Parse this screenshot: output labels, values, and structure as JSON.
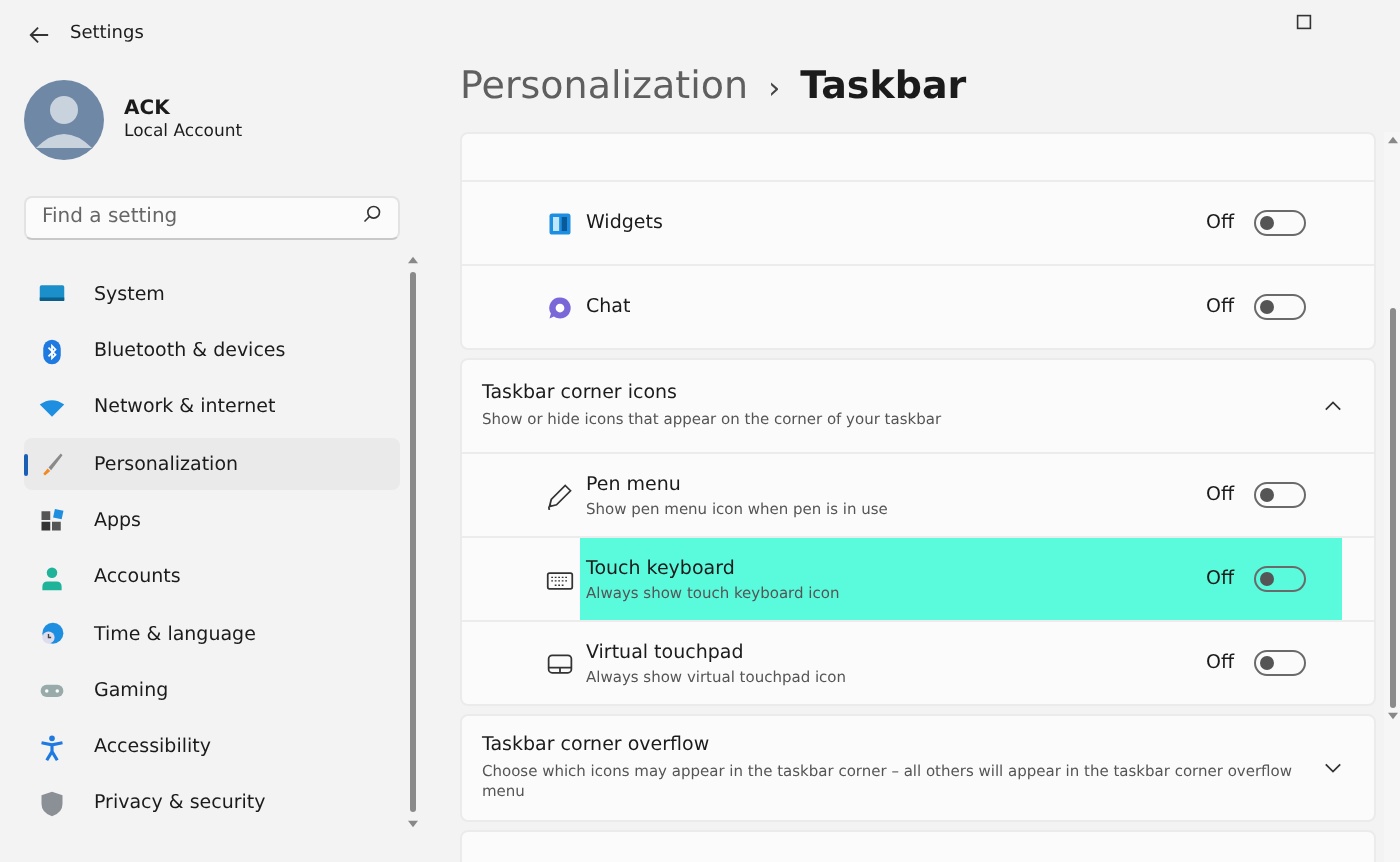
{
  "window": {
    "title": "Settings"
  },
  "account": {
    "name": "ACK",
    "type": "Local Account"
  },
  "search": {
    "placeholder": "Find a setting"
  },
  "sidebar": {
    "items": [
      {
        "label": "System",
        "kind": "system",
        "selected": false
      },
      {
        "label": "Bluetooth & devices",
        "kind": "bluetooth",
        "selected": false
      },
      {
        "label": "Network & internet",
        "kind": "network",
        "selected": false
      },
      {
        "label": "Personalization",
        "kind": "brush",
        "selected": true
      },
      {
        "label": "Apps",
        "kind": "apps",
        "selected": false
      },
      {
        "label": "Accounts",
        "kind": "person",
        "selected": false
      },
      {
        "label": "Time & language",
        "kind": "globe",
        "selected": false
      },
      {
        "label": "Gaming",
        "kind": "gamepad",
        "selected": false
      },
      {
        "label": "Accessibility",
        "kind": "accessibility",
        "selected": false
      },
      {
        "label": "Privacy & security",
        "kind": "shield",
        "selected": false
      }
    ]
  },
  "breadcrumb": {
    "parent": "Personalization",
    "separator": "›",
    "current": "Taskbar"
  },
  "taskbar_items": [
    {
      "label": "Widgets",
      "kind": "widgets",
      "state": "Off",
      "on": false
    },
    {
      "label": "Chat",
      "kind": "chat",
      "state": "Off",
      "on": false
    }
  ],
  "corner_icons": {
    "title": "Taskbar corner icons",
    "description": "Show or hide icons that appear on the corner of your taskbar",
    "expanded": true,
    "items": [
      {
        "label": "Pen menu",
        "description": "Show pen menu icon when pen is in use",
        "kind": "pen",
        "state": "Off",
        "on": false,
        "highlighted": false
      },
      {
        "label": "Touch keyboard",
        "description": "Always show touch keyboard icon",
        "kind": "keyboard",
        "state": "Off",
        "on": false,
        "highlighted": true
      },
      {
        "label": "Virtual touchpad",
        "description": "Always show virtual touchpad icon",
        "kind": "touchpad",
        "state": "Off",
        "on": false,
        "highlighted": false
      }
    ]
  },
  "corner_overflow": {
    "title": "Taskbar corner overflow",
    "description": "Choose which icons may appear in the taskbar corner – all others will appear in the taskbar corner overflow menu",
    "expanded": false
  }
}
